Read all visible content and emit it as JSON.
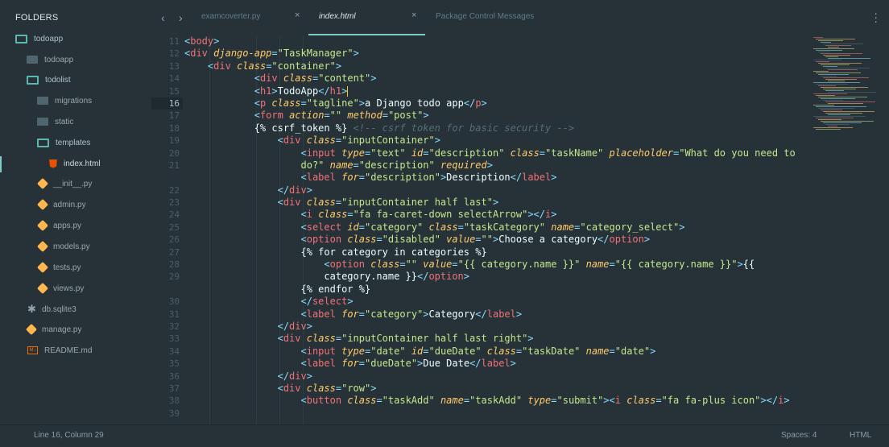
{
  "sidebar": {
    "title": "FOLDERS",
    "items": [
      {
        "label": "todoapp",
        "icon": "folder-open-icon"
      },
      {
        "label": "todoapp",
        "icon": "folder-icon"
      },
      {
        "label": "todolist",
        "icon": "folder-open-icon"
      },
      {
        "label": "migrations",
        "icon": "folder-icon"
      },
      {
        "label": "static",
        "icon": "folder-icon"
      },
      {
        "label": "templates",
        "icon": "folder-open-icon"
      },
      {
        "label": "index.html",
        "icon": "html5-icon"
      },
      {
        "label": "__init__.py",
        "icon": "python-icon"
      },
      {
        "label": "admin.py",
        "icon": "python-icon"
      },
      {
        "label": "apps.py",
        "icon": "python-icon"
      },
      {
        "label": "models.py",
        "icon": "python-icon"
      },
      {
        "label": "tests.py",
        "icon": "python-icon"
      },
      {
        "label": "views.py",
        "icon": "python-icon"
      },
      {
        "label": "db.sqlite3",
        "icon": "database-icon"
      },
      {
        "label": "manage.py",
        "icon": "python-icon"
      },
      {
        "label": "README.md",
        "icon": "markdown-icon"
      }
    ]
  },
  "tabs": [
    {
      "label": "examcoverter.py",
      "active": false
    },
    {
      "label": "index.html",
      "active": true
    },
    {
      "label": "Package Control Messages",
      "active": false
    }
  ],
  "editor": {
    "gutter": [
      "11",
      "12",
      "13",
      "14",
      "15",
      "16",
      "17",
      "18",
      "19",
      "20",
      "21",
      "",
      "22",
      "23",
      "24",
      "25",
      "26",
      "27",
      "28",
      "29",
      "",
      "30",
      "31",
      "32",
      "33",
      "34",
      "35",
      "36",
      "37",
      "38",
      "39"
    ],
    "current_line": "16",
    "minimap_color": "#80cbc4"
  },
  "status": {
    "position": "Line 16, Column 29",
    "spaces": "Spaces: 4",
    "syntax": "HTML"
  },
  "colors": {
    "background": "#263238",
    "accent": "#80cbc4",
    "tag": "#f07178",
    "attr": "#ffcb6b",
    "string": "#c3e88d",
    "punct": "#89ddff",
    "comment": "#546e7a"
  }
}
